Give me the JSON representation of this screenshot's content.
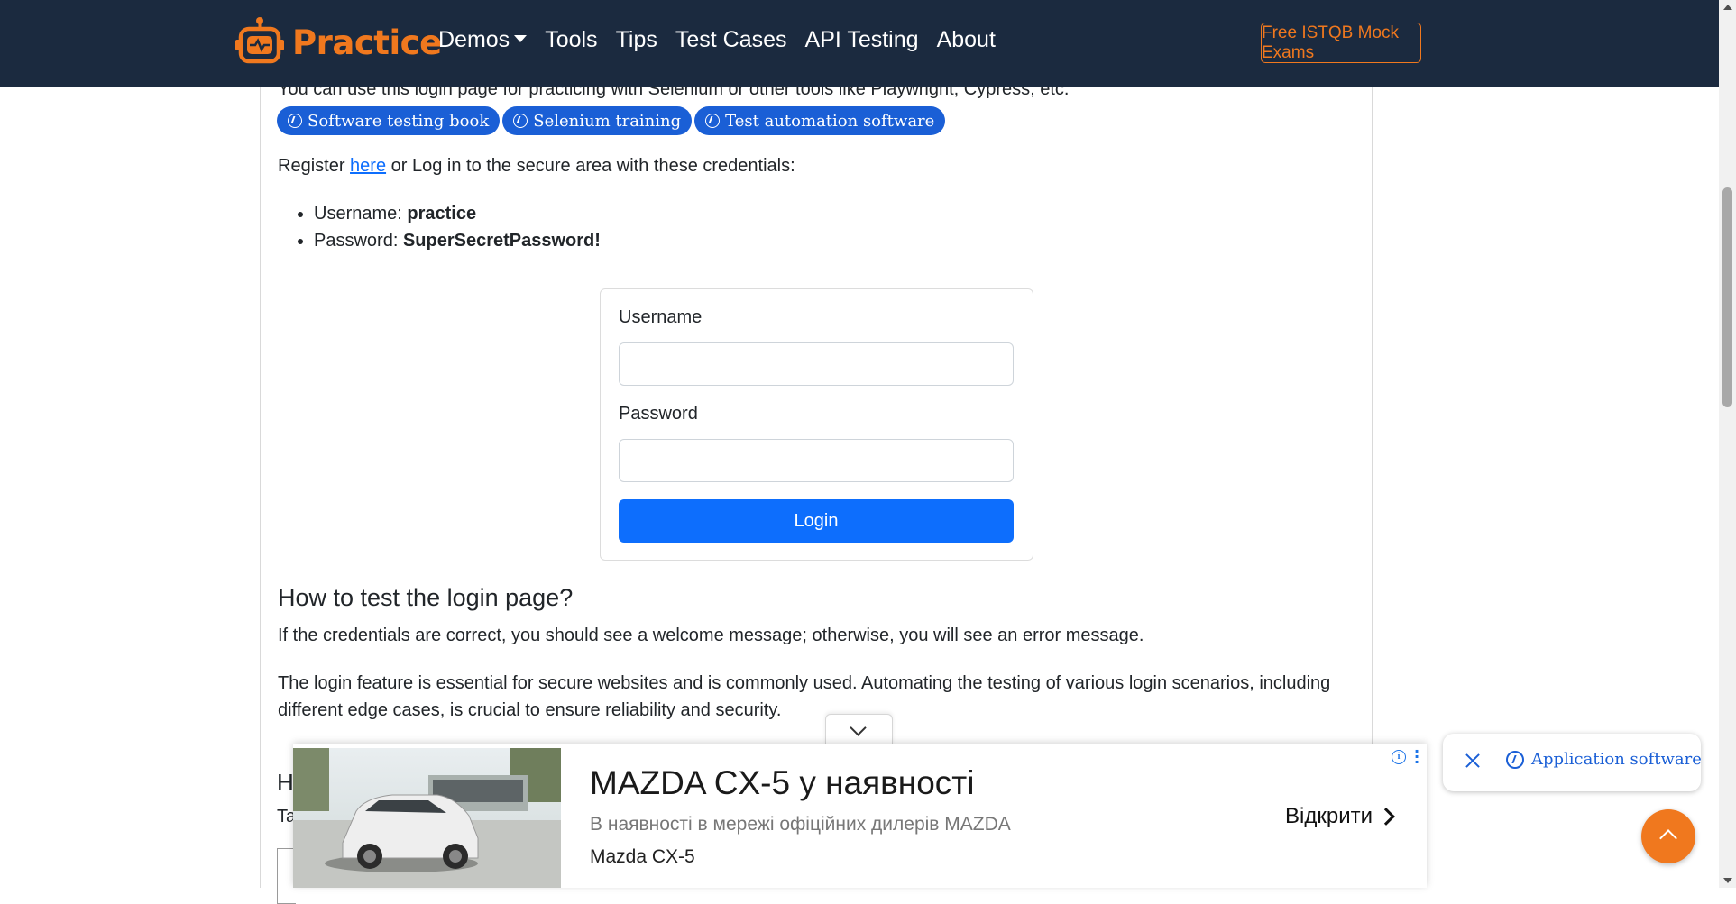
{
  "nav": {
    "brand": "Practice",
    "items": [
      "Demos",
      "Tools",
      "Tips",
      "Test Cases",
      "API Testing",
      "About"
    ],
    "cta": "Free ISTQB Mock Exams",
    "brand_color": "#f0781e",
    "bg_color": "#1b2a3f"
  },
  "intro": "You can use this login page for practicing with Selenium or other tools like Playwright, Cypress, etc.",
  "pills": [
    "Software testing book",
    "Selenium training",
    "Test automation software"
  ],
  "register": {
    "prefix": "Register ",
    "link": "here",
    "suffix": " or Log in to the secure area with these credentials:"
  },
  "credentials": {
    "username_label": "Username: ",
    "username_value": "practice",
    "password_label": "Password: ",
    "password_value": "SuperSecretPassword!"
  },
  "login_form": {
    "username_label": "Username",
    "username_value": "",
    "password_label": "Password",
    "password_value": "",
    "submit_label": "Login"
  },
  "how_to": {
    "heading": "How to test the login page?",
    "p1": "If the credentials are correct, you should see a welcome message; otherwise, you will see an error message.",
    "p2": "The login feature is essential for secure websites and is commonly used. Automating the testing of various login scenarios, including different edge cases, is crucial to ensure reliability and security.",
    "peek_heading": "H",
    "peek_text": "Ta"
  },
  "ad": {
    "headline": "MAZDA CX-5 у наявності",
    "description": "В наявності в мережі офіційних дилерів MAZDA",
    "model": "Mazda CX-5",
    "cta": "Відкрити"
  },
  "side_pill": {
    "label": "Application software"
  }
}
